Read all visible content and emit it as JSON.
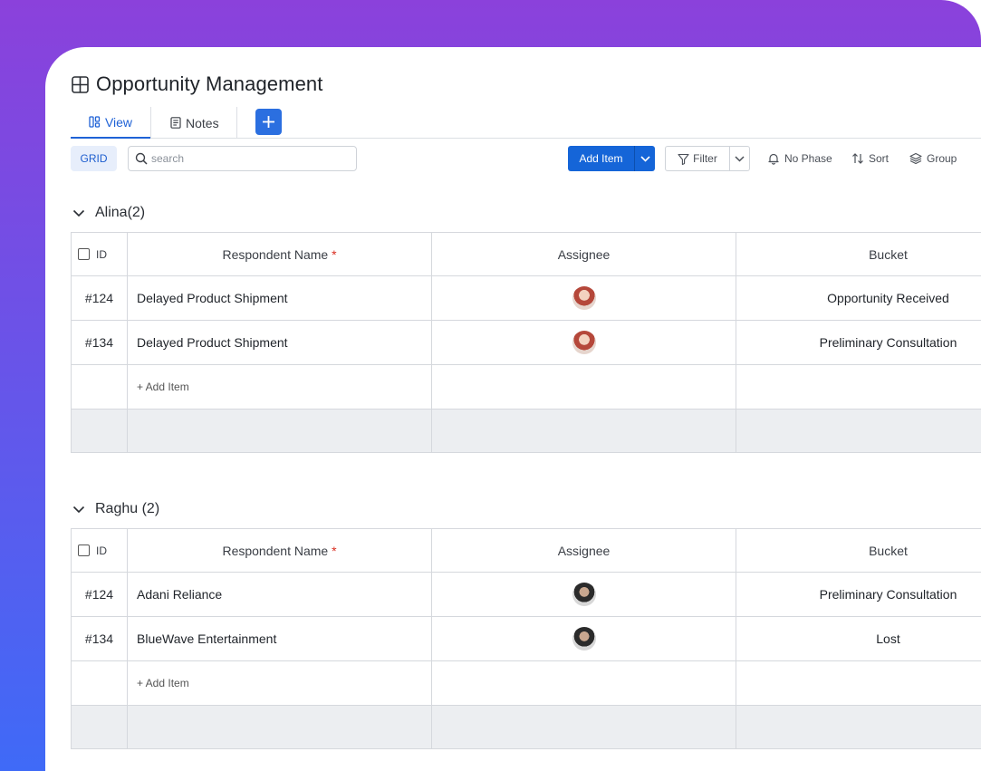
{
  "page": {
    "title": "Opportunity Management"
  },
  "tabs": [
    {
      "label": "View",
      "active": true,
      "icon": "view-icon"
    },
    {
      "label": "Notes",
      "active": false,
      "icon": "notes-icon"
    }
  ],
  "toolbar": {
    "grid_label": "GRID",
    "search_placeholder": "search",
    "add_item_label": "Add Item",
    "filter_label": "Filter",
    "no_phase_label": "No Phase",
    "sort_label": "Sort",
    "group_label": "Group"
  },
  "columns": {
    "id": "ID",
    "name": "Respondent Name",
    "required_mark": "*",
    "assignee": "Assignee",
    "bucket": "Bucket"
  },
  "add_row_label": "+ Add Item",
  "groups": [
    {
      "title": "Alina(2)",
      "rows": [
        {
          "id": "#124",
          "name": "Delayed Product Shipment",
          "assignee": "female-avatar",
          "bucket": "Opportunity Received"
        },
        {
          "id": "#134",
          "name": "Delayed Product Shipment",
          "assignee": "female-avatar",
          "bucket": "Preliminary Consultation"
        }
      ]
    },
    {
      "title": "Raghu (2)",
      "rows": [
        {
          "id": "#124",
          "name": "Adani Reliance",
          "assignee": "male-avatar",
          "bucket": "Preliminary Consultation"
        },
        {
          "id": "#134",
          "name": "BlueWave Entertainment",
          "assignee": "male-avatar",
          "bucket": "Lost"
        }
      ]
    }
  ],
  "colors": {
    "accent": "#1565d8",
    "gradient_top": "#8b41db",
    "gradient_bottom": "#3f6af7"
  }
}
